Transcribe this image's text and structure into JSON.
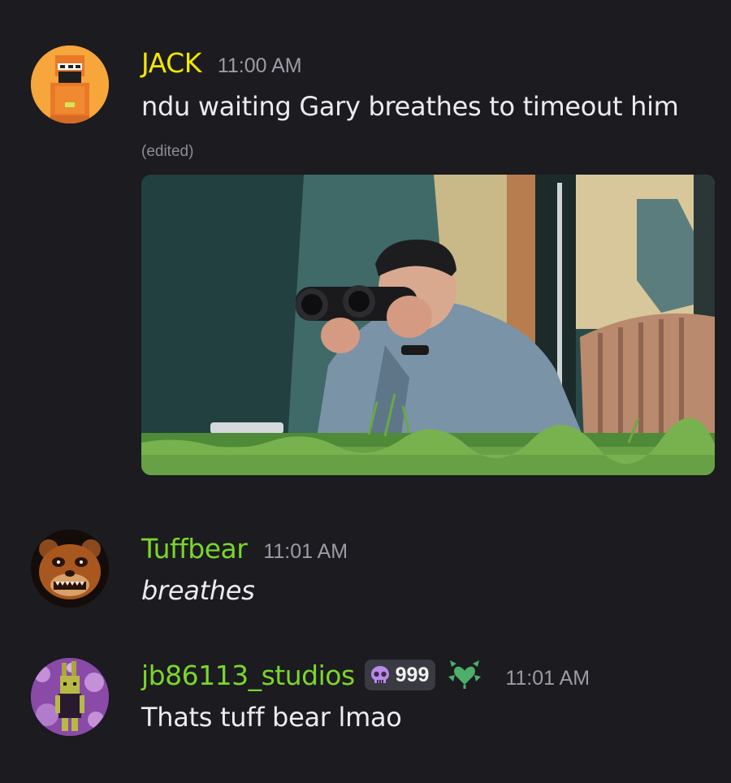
{
  "messages": [
    {
      "username": "JACK",
      "username_color": "#f3e600",
      "timestamp": "11:00 AM",
      "text": "ndu waiting Gary breathes to timeout him",
      "edited_label": "(edited)",
      "avatar_icon": "orange-pixel-character-avatar",
      "attachment": "photo-man-with-binoculars"
    },
    {
      "username": "Tuffbear",
      "username_color": "#7cd62a",
      "timestamp": "11:01 AM",
      "text": "breathes",
      "avatar_icon": "animatronic-bear-avatar"
    },
    {
      "username": "jb86113_studios",
      "username_color": "#7cd62a",
      "timestamp": "11:01 AM",
      "text": "Thats tuff bear lmao",
      "badge_icon": "purple-skull-icon",
      "badge_count": "999",
      "role_icon": "green-leaf-heart-icon",
      "avatar_icon": "purple-rabbit-avatar"
    }
  ]
}
